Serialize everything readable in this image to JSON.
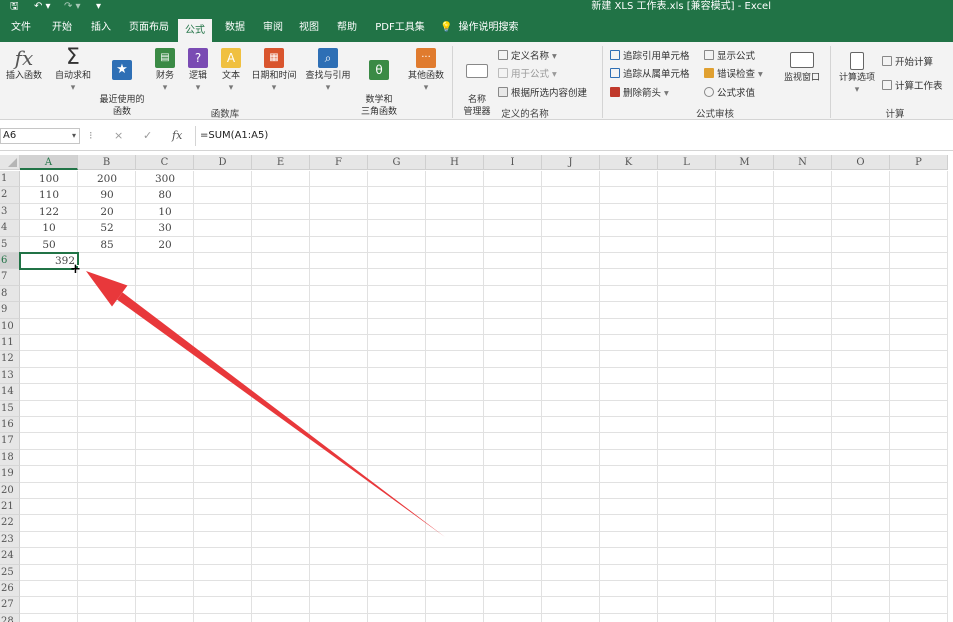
{
  "titlebar": {
    "save_icon": "save-icon",
    "undo_icon": "undo-icon",
    "redo_icon": "redo-icon",
    "title": "新建 XLS 工作表.xls  [兼容模式]  -  Excel"
  },
  "tabs": [
    "文件",
    "开始",
    "插入",
    "页面布局",
    "公式",
    "数据",
    "审阅",
    "视图",
    "帮助",
    "PDF工具集"
  ],
  "active_tab": "公式",
  "tell_me": "操作说明搜索",
  "ribbon": {
    "function_library": {
      "label": "函数库",
      "buttons": [
        {
          "label": "插入函数",
          "icon": "fx-icon",
          "color": "#555555"
        },
        {
          "label": "自动求和",
          "icon": "sigma-icon",
          "color": "#333333"
        },
        {
          "label": "最近使用的\n函数",
          "icon": "star-icon",
          "color": "#2e6fb5"
        },
        {
          "label": "财务",
          "icon": "book-icon",
          "color": "#3a8a45"
        },
        {
          "label": "逻辑",
          "icon": "question-icon",
          "color": "#7a4bb3"
        },
        {
          "label": "文本",
          "icon": "text-a-icon",
          "color": "#e0a030"
        },
        {
          "label": "日期和时间",
          "icon": "calendar-icon",
          "color": "#d9552e"
        },
        {
          "label": "查找与引用",
          "icon": "magnifier-icon",
          "color": "#2e6fb5"
        },
        {
          "label": "数学和\n三角函数",
          "icon": "theta-icon",
          "color": "#3a8a45"
        },
        {
          "label": "其他函数",
          "icon": "more-icon",
          "color": "#e07b2e"
        }
      ]
    },
    "defined_names": {
      "label": "定义的名称",
      "name_manager": "名称\n管理器",
      "define_name": "定义名称",
      "use_in_formula": "用于公式",
      "create_from_selection": "根据所选内容创建"
    },
    "formula_auditing": {
      "label": "公式审核",
      "trace_precedents": "追踪引用单元格",
      "trace_dependents": "追踪从属单元格",
      "remove_arrows": "删除箭头",
      "show_formulas": "显示公式",
      "error_checking": "错误检查",
      "evaluate_formula": "公式求值",
      "watch_window": "监视窗口"
    },
    "calculation": {
      "label": "计算",
      "calc_options": "计算选项",
      "calc_now": "开始计算",
      "calc_sheet": "计算工作表"
    }
  },
  "formula_bar": {
    "name_box": "A6",
    "cancel_icon": "×",
    "enter_icon": "✓",
    "fx": "fx",
    "formula": "=SUM(A1:A5)"
  },
  "columns": [
    "A",
    "B",
    "C",
    "D",
    "E",
    "F",
    "G",
    "H",
    "I",
    "J",
    "K",
    "L",
    "M",
    "N",
    "O",
    "P"
  ],
  "rows": [
    "1",
    "2",
    "3",
    "4",
    "5",
    "6",
    "7",
    "8",
    "9",
    "10",
    "11",
    "12",
    "13",
    "14",
    "15",
    "16",
    "17",
    "18",
    "19",
    "20",
    "21",
    "22",
    "23",
    "24",
    "25",
    "26",
    "27",
    "28"
  ],
  "sheet": {
    "data": [
      [
        "100",
        "200",
        "300"
      ],
      [
        "110",
        "90",
        "80"
      ],
      [
        "122",
        "20",
        "10"
      ],
      [
        "10",
        "52",
        "30"
      ],
      [
        "50",
        "85",
        "20"
      ]
    ],
    "sum_cell": "A6",
    "sum_value": "392"
  },
  "colors": {
    "accent": "#217346",
    "arrow": "#e8383b"
  }
}
